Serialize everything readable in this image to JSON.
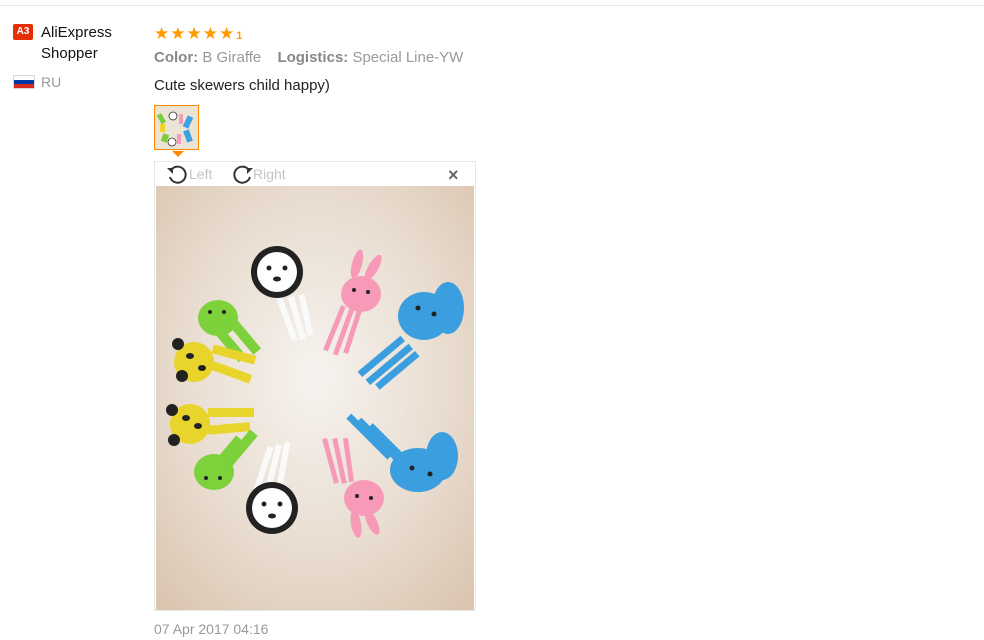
{
  "review": {
    "user": {
      "badge": "A3",
      "name": "AliExpress Shopper",
      "country": "RU",
      "flag_colors": [
        "#ffffff",
        "#0039a6",
        "#d52b1e"
      ]
    },
    "rating": {
      "stars": 5,
      "max": 5,
      "extra_mark": "1",
      "star_color": "#ff9a00"
    },
    "attributes": [
      {
        "key": "Color:",
        "value": "B Giraffe"
      },
      {
        "key": "Logistics:",
        "value": "Special Line-YW"
      }
    ],
    "text": "Cute skewers child happy)",
    "photo_count": 1,
    "viewer": {
      "rotate_left_label": "Left",
      "rotate_right_label": "Right",
      "close_icon": "close-icon"
    },
    "date": "07 Apr 2017 04:16"
  },
  "colors": {
    "accent": "#ff8a00",
    "badge": "#e62e04",
    "muted_text": "#999999"
  }
}
